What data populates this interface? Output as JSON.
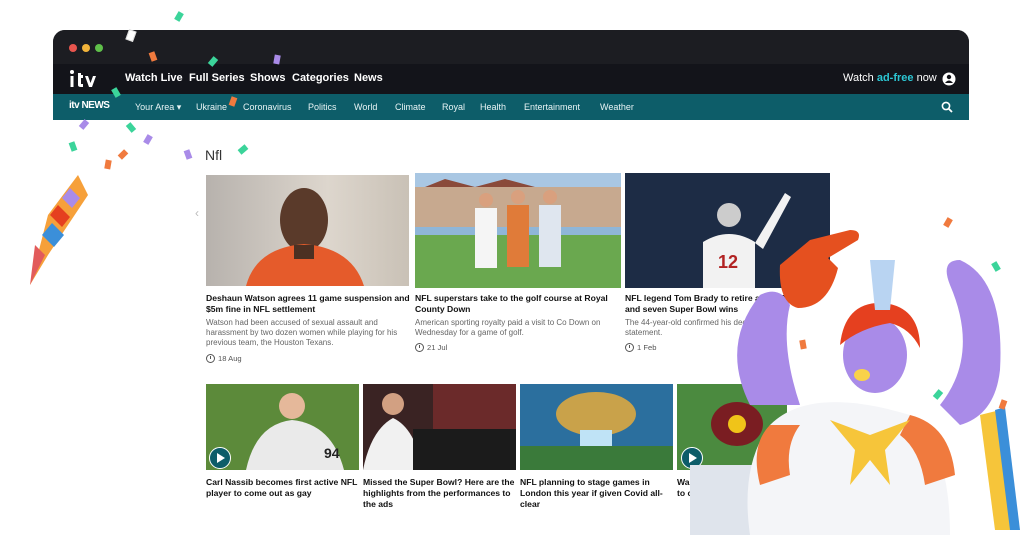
{
  "top_nav": {
    "items": [
      "Watch Live",
      "Full Series",
      "Shows",
      "Categories",
      "News"
    ],
    "watch_prefix": "Watch ",
    "watch_highlight": "ad-free",
    "watch_suffix": " now"
  },
  "news_nav": {
    "logo_text": "itv NEWS",
    "your_area": "Your Area",
    "items": [
      "Ukraine",
      "Coronavirus",
      "Politics",
      "World",
      "Climate",
      "Royal",
      "Health",
      "Entertainment",
      "Weather"
    ]
  },
  "page": {
    "title": "Nfl"
  },
  "articles_row1": [
    {
      "title": "Deshaun Watson agrees 11 game suspension and $5m fine in NFL settlement",
      "desc": "Watson had been accused of sexual assault and harassment by two dozen women while playing for his previous team, the Houston Texans.",
      "date": "18 Aug"
    },
    {
      "title": "NFL superstars take to the golf course at Royal County Down",
      "desc": "American sporting royalty paid a visit to Co Down on Wednesday for a game of golf.",
      "date": "21 Jul"
    },
    {
      "title": "NFL legend Tom Brady to retire after 22 and seven Super Bowl wins",
      "desc": "The 44-year-old confirmed his decisio statement.",
      "date": "1 Feb"
    }
  ],
  "articles_row2": [
    {
      "title": "Carl Nassib becomes first active NFL player to come out as gay"
    },
    {
      "title": "Missed the Super Bowl? Here are the highlights from the performances to the ads"
    },
    {
      "title": "NFL planning to stage games in London this year if given Covid all-clear"
    },
    {
      "title": "Wa to c"
    }
  ],
  "colors": {
    "accent_teal": "#0d5d69",
    "ad_free": "#2cc6d3",
    "nav_bg": "#13141a"
  }
}
